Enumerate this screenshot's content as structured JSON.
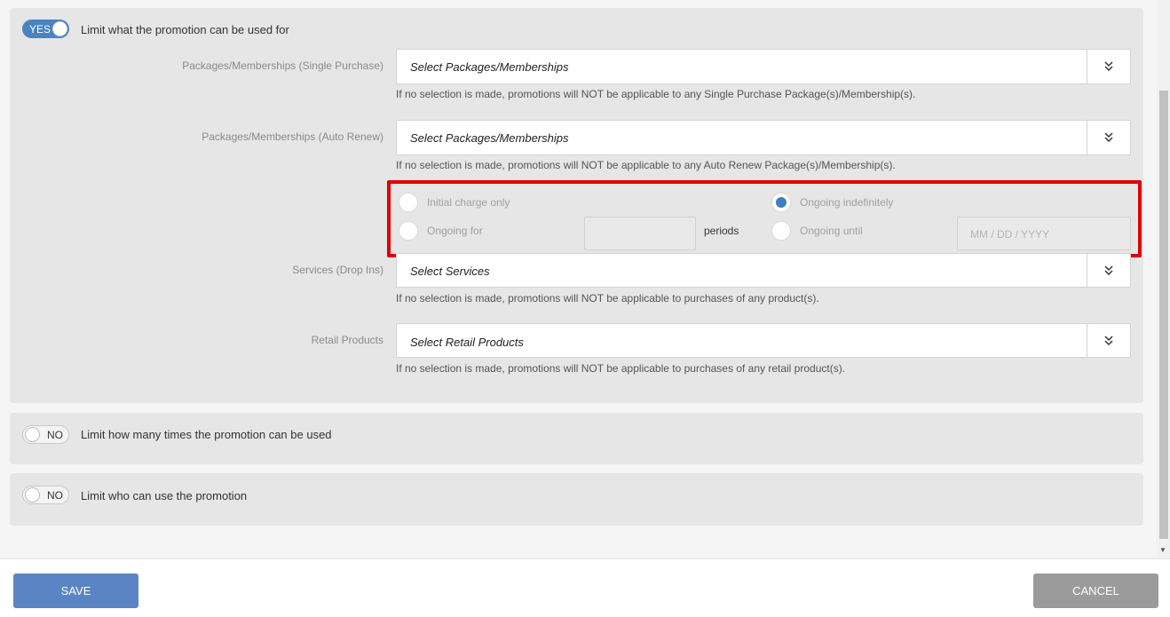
{
  "usage_section": {
    "toggle_label": "YES",
    "title": "Limit what the promotion can be used for",
    "single_purchase": {
      "label": "Packages/Memberships (Single Purchase)",
      "placeholder": "Select Packages/Memberships",
      "help": "If no selection is made, promotions will NOT be applicable to any Single Purchase Package(s)/Membership(s)."
    },
    "auto_renew": {
      "label": "Packages/Memberships (Auto Renew)",
      "placeholder": "Select Packages/Memberships",
      "help": "If no selection is made, promotions will NOT be applicable to any Auto Renew Package(s)/Membership(s).",
      "options": {
        "initial_charge_only": "Initial charge only",
        "ongoing_indefinitely": "Ongoing indefinitely",
        "ongoing_for": "Ongoing for",
        "periods": "periods",
        "ongoing_until": "Ongoing until",
        "date_placeholder": "MM / DD / YYYY",
        "selected": "Ongoing indefinitely"
      }
    },
    "services": {
      "label": "Services (Drop Ins)",
      "placeholder": "Select Services",
      "help": "If no selection is made, promotions will NOT be applicable to purchases of any product(s)."
    },
    "retail": {
      "label": "Retail Products",
      "placeholder": "Select Retail Products",
      "help": "If no selection is made, promotions will NOT be applicable to purchases of any retail product(s)."
    }
  },
  "times_section": {
    "toggle_label": "NO",
    "title": "Limit how many times the promotion can be used"
  },
  "who_section": {
    "toggle_label": "NO",
    "title": "Limit who can use the promotion"
  },
  "footer": {
    "save_label": "SAVE",
    "cancel_label": "CANCEL"
  },
  "colors": {
    "toggle_on": "#4a83c0",
    "save_button": "#5b84c4",
    "cancel_button": "#9b9b9b",
    "highlight": "#e10000",
    "radio_selected": "#3f7fc1"
  },
  "icons": {
    "dropdown": "double-chevron-down-icon"
  }
}
